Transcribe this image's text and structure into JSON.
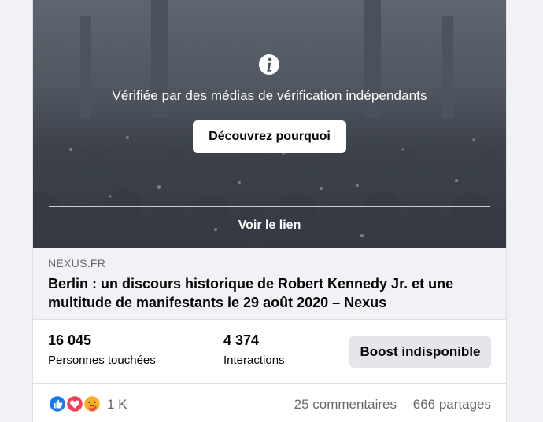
{
  "media": {
    "warning_text": "Vérifiée par des médias de vérification indépendants",
    "discover_button": "Découvrez pourquoi",
    "see_link": "Voir le lien",
    "icon": "info-icon"
  },
  "link": {
    "domain": "NEXUS.FR",
    "headline": "Berlin : un discours historique de Robert Kennedy Jr. et une multitude de manifestants le 29 août 2020 – Nexus"
  },
  "stats": {
    "reach_value": "16 045",
    "reach_label": "Personnes touchées",
    "interactions_value": "4 374",
    "interactions_label": "Interactions",
    "boost_button": "Boost indisponible"
  },
  "reactions": {
    "icons": [
      "like-icon",
      "love-icon",
      "care-icon"
    ],
    "count": "1 K",
    "comments": "25 commentaires",
    "shares": "666 partages"
  },
  "colors": {
    "like": "#1877f2",
    "love": "#f33e58",
    "care": "#f7b125",
    "secondary_text": "#65676b",
    "button_gray": "#e4e6eb"
  }
}
